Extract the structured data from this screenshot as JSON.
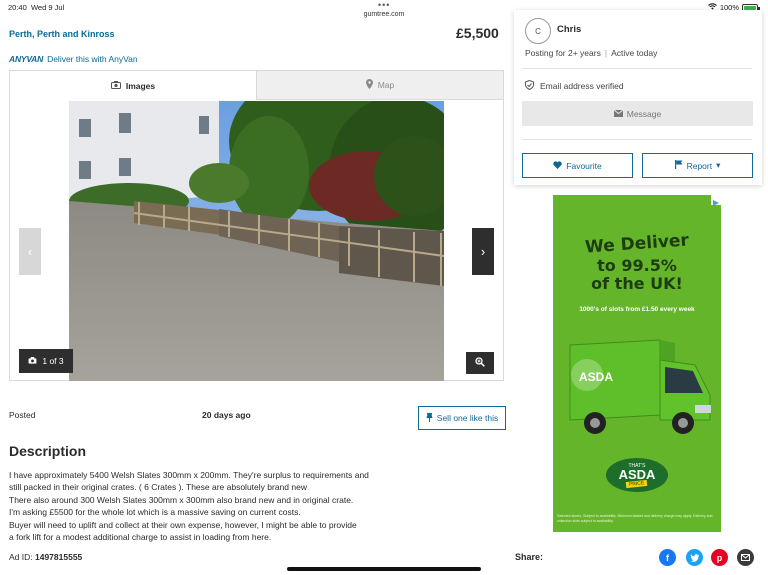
{
  "status_bar": {
    "time": "20:40",
    "date": "Wed 9 Jul",
    "url": "gumtree.com",
    "battery": "100%",
    "battery_level": 1.0
  },
  "listing": {
    "location": "Perth, Perth and Kinross",
    "price": "£5,500",
    "delivery": {
      "brand": "ANYVAN",
      "text": "Deliver this with AnyVan"
    }
  },
  "gallery": {
    "tabs": [
      {
        "label": "Images",
        "active": true
      },
      {
        "label": "Map",
        "active": false
      }
    ],
    "counter": "1 of 3"
  },
  "posted": {
    "label": "Posted",
    "value": "20 days ago"
  },
  "sell_button": "Sell one like this",
  "description": {
    "title": "Description",
    "lines": [
      "I have approximately 5400 Welsh Slates 300mm x 200mm. They're surplus to requirements and",
      "still packed in their original crates. ( 6 Crates ). These are absolutely brand new",
      "There also around 300 Welsh Slates 300mm x 300mm also brand new and in original crate.",
      "I'm asking £5500 for the whole lot which is a massive saving on current costs.",
      "Buyer will need to uplift and collect at their own expense, however, I might be able to provide",
      "a fork lift for a modest additional charge to assist in loading from here."
    ],
    "ad_id_label": "Ad ID:",
    "ad_id": "1497815555"
  },
  "seller": {
    "initial": "C",
    "name": "Chris",
    "posting_for": "Posting for 2+ years",
    "activity": "Active today",
    "verified": "Email address verified",
    "message_button": "Message",
    "favourite_button": "Favourite",
    "report_button": "Report"
  },
  "advert": {
    "headline_1": "We Deliver",
    "headline_2": "to 99.5%",
    "headline_3": "of the UK!",
    "subline": "1000's of slots from £1.50 every week",
    "logo_top": "THAT'S",
    "logo_brand": "ASDA",
    "logo_price": "PRICE",
    "van_brand": "ASDA",
    "fine_print": "Selected stores. Subject to availability. Minimum basket and delivery charge may apply. Delivery and collection slots subject to availability."
  },
  "share": {
    "label": "Share:",
    "icons": [
      "facebook-icon",
      "twitter-icon",
      "pinterest-icon",
      "email-icon"
    ]
  },
  "colors": {
    "link_blue": "#0e6a96",
    "ad_green": "#64b52a",
    "facebook": "#1877f2",
    "twitter": "#1da1f2",
    "pinterest": "#e60023",
    "email": "#3a3a3a"
  }
}
